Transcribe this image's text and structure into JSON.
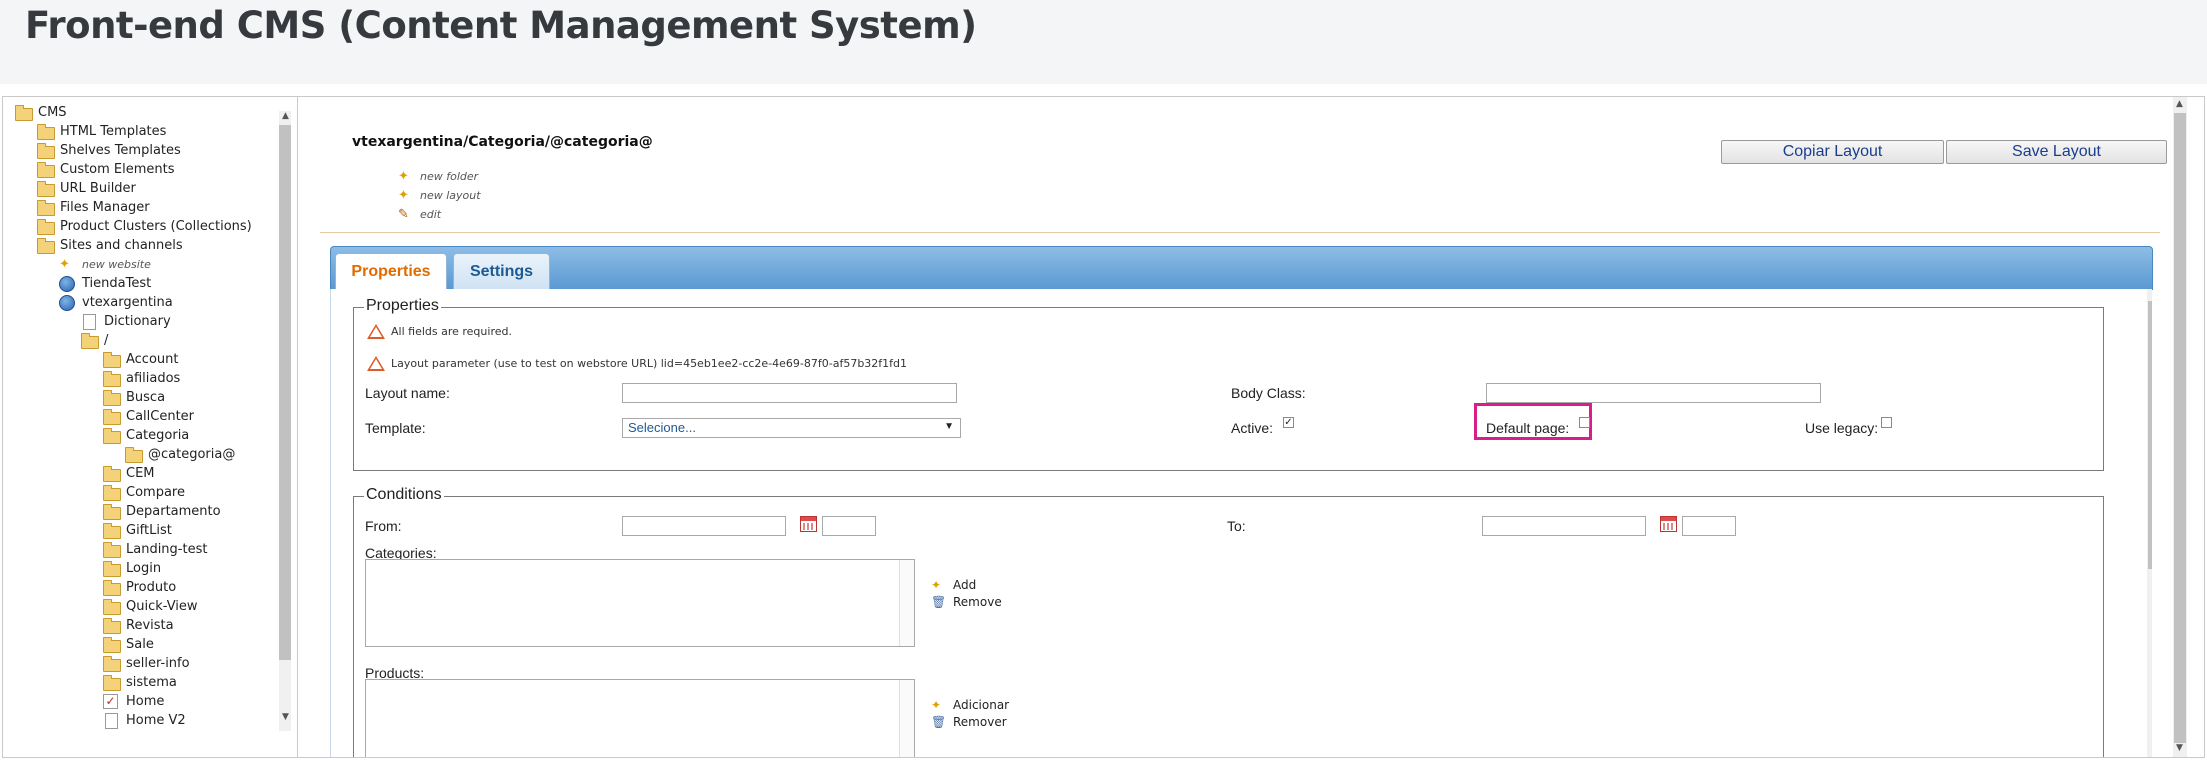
{
  "page": {
    "title": "Front-end CMS (Content Management System)"
  },
  "tree": {
    "items": [
      {
        "label": "CMS",
        "icon": "folder-open-icon"
      },
      {
        "label": "HTML Templates",
        "icon": "html-templates-icon"
      },
      {
        "label": "Shelves Templates",
        "icon": "shelves-templates-icon"
      },
      {
        "label": "Custom Elements",
        "icon": "custom-elements-icon"
      },
      {
        "label": "URL Builder",
        "icon": "url-builder-icon"
      },
      {
        "label": "Files Manager",
        "icon": "folder-icon"
      },
      {
        "label": "Product Clusters (Collections)",
        "icon": "folder-icon"
      },
      {
        "label": "Sites and channels",
        "icon": "folder-open-icon"
      },
      {
        "label": "new website",
        "icon": "new-icon"
      },
      {
        "label": "TiendaTest",
        "icon": "globe-icon"
      },
      {
        "label": "vtexargentina",
        "icon": "globe-icon"
      },
      {
        "label": "Dictionary",
        "icon": "document-icon"
      },
      {
        "label": "/",
        "icon": "folder-open-icon"
      },
      {
        "label": "Account",
        "icon": "folder-icon"
      },
      {
        "label": "afiliados",
        "icon": "folder-icon"
      },
      {
        "label": "Busca",
        "icon": "folder-icon"
      },
      {
        "label": "CallCenter",
        "icon": "folder-icon"
      },
      {
        "label": "Categoria",
        "icon": "folder-open-icon"
      },
      {
        "label": "@categoria@",
        "icon": "folder-icon"
      },
      {
        "label": "CEM",
        "icon": "folder-icon"
      },
      {
        "label": "Compare",
        "icon": "folder-icon"
      },
      {
        "label": "Departamento",
        "icon": "folder-icon"
      },
      {
        "label": "GiftList",
        "icon": "folder-icon"
      },
      {
        "label": "Landing-test",
        "icon": "folder-icon"
      },
      {
        "label": "Login",
        "icon": "folder-icon"
      },
      {
        "label": "Produto",
        "icon": "folder-icon"
      },
      {
        "label": "Quick-View",
        "icon": "folder-icon"
      },
      {
        "label": "Revista",
        "icon": "folder-icon"
      },
      {
        "label": "Sale",
        "icon": "folder-icon"
      },
      {
        "label": "seller-info",
        "icon": "folder-icon"
      },
      {
        "label": "sistema",
        "icon": "folder-icon"
      },
      {
        "label": "Home",
        "icon": "page-check-icon"
      },
      {
        "label": "Home V2",
        "icon": "page-icon"
      }
    ]
  },
  "main": {
    "path": "vtexargentina/Categoria/@categoria@",
    "actions": {
      "new_folder": "new folder",
      "new_layout": "new layout",
      "edit": "edit"
    },
    "buttons": {
      "copy": "Copiar Layout",
      "save": "Save Layout"
    },
    "tabs": {
      "properties": "Properties",
      "settings": "Settings"
    },
    "properties": {
      "legend": "Properties",
      "warning_required": "All fields are required.",
      "warning_layout_param": "Layout parameter (use to test on webstore URL) lid=45eb1ee2-cc2e-4e69-87f0-af57b32f1fd1",
      "layout_name_label": "Layout name:",
      "layout_name_value": "",
      "body_class_label": "Body Class:",
      "body_class_value": "",
      "template_label": "Template:",
      "template_value": "Selecione...",
      "active_label": "Active:",
      "active_checked": true,
      "default_page_label": "Default page:",
      "default_page_checked": false,
      "use_legacy_label": "Use legacy:",
      "use_legacy_checked": false
    },
    "conditions": {
      "legend": "Conditions",
      "from_label": "From:",
      "to_label": "To:",
      "categories_label": "Categories:",
      "add_label": "Add",
      "remove_label": "Remove",
      "products_label": "Products:",
      "adicionar_label": "Adicionar",
      "remover_label": "Remover"
    }
  },
  "colors": {
    "highlight": "#d91e8a",
    "active_tab_text": "#e06b00",
    "tabbar": "#6ba6d9"
  }
}
